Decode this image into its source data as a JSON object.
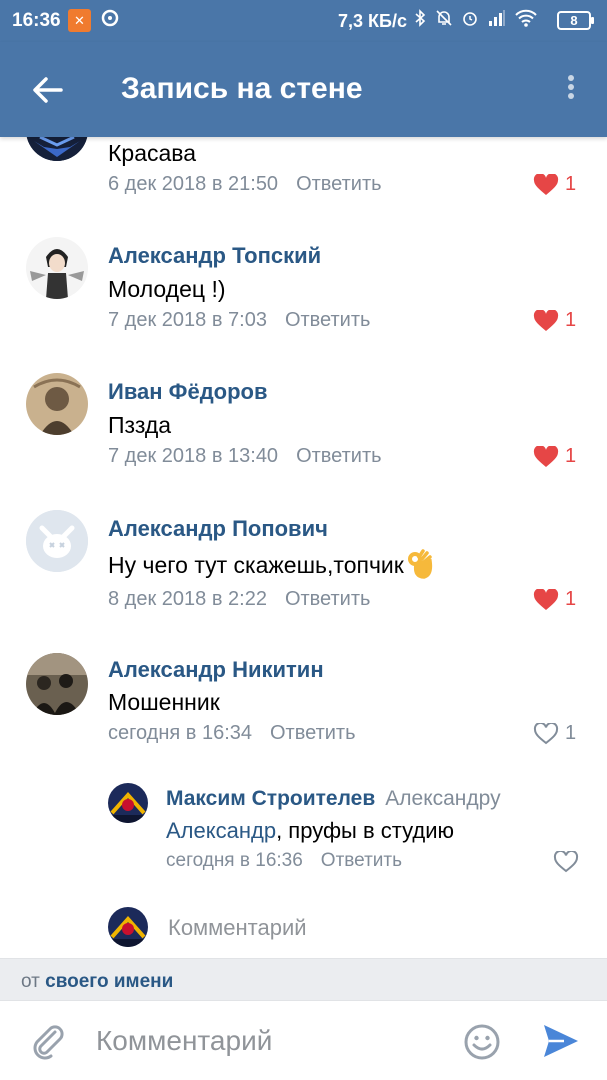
{
  "status_bar": {
    "time": "16:36",
    "notification": "✕",
    "network_speed": "7,3 КБ/с",
    "battery": "8"
  },
  "app_bar": {
    "title": "Запись на стене"
  },
  "comments": [
    {
      "name": "",
      "text": "Красава",
      "date": "6 дек 2018 в 21:50",
      "reply_label": "Ответить",
      "likes": "1",
      "liked": true
    },
    {
      "name": "Александр Топский",
      "text": "Молодец !)",
      "date": "7 дек 2018 в 7:03",
      "reply_label": "Ответить",
      "likes": "1",
      "liked": true
    },
    {
      "name": "Иван Фёдоров",
      "text": "Пззда",
      "date": "7 дек 2018 в 13:40",
      "reply_label": "Ответить",
      "likes": "1",
      "liked": true
    },
    {
      "name": "Александр Попович",
      "text": "Ну чего тут скажешь,топчик",
      "date": "8 дек 2018 в 2:22",
      "reply_label": "Ответить",
      "likes": "1",
      "liked": true
    },
    {
      "name": "Александр Никитин",
      "text": "Мошенник",
      "date": "сегодня в 16:34",
      "reply_label": "Ответить",
      "likes": "1",
      "liked": false
    }
  ],
  "reply": {
    "name": "Максим Строителев",
    "reply_to": "Александру",
    "mention": "Александр",
    "text": ", пруфы в студию",
    "date": "сегодня в 16:36",
    "reply_label": "Ответить"
  },
  "reply_input": {
    "placeholder": "Комментарий"
  },
  "post_as": {
    "prefix": "от",
    "link": "своего имени"
  },
  "input_bar": {
    "placeholder": "Комментарий"
  },
  "colors": {
    "header": "#4a76a8",
    "link": "#2a5885",
    "meta": "#818c99",
    "like_active": "#e64646"
  }
}
